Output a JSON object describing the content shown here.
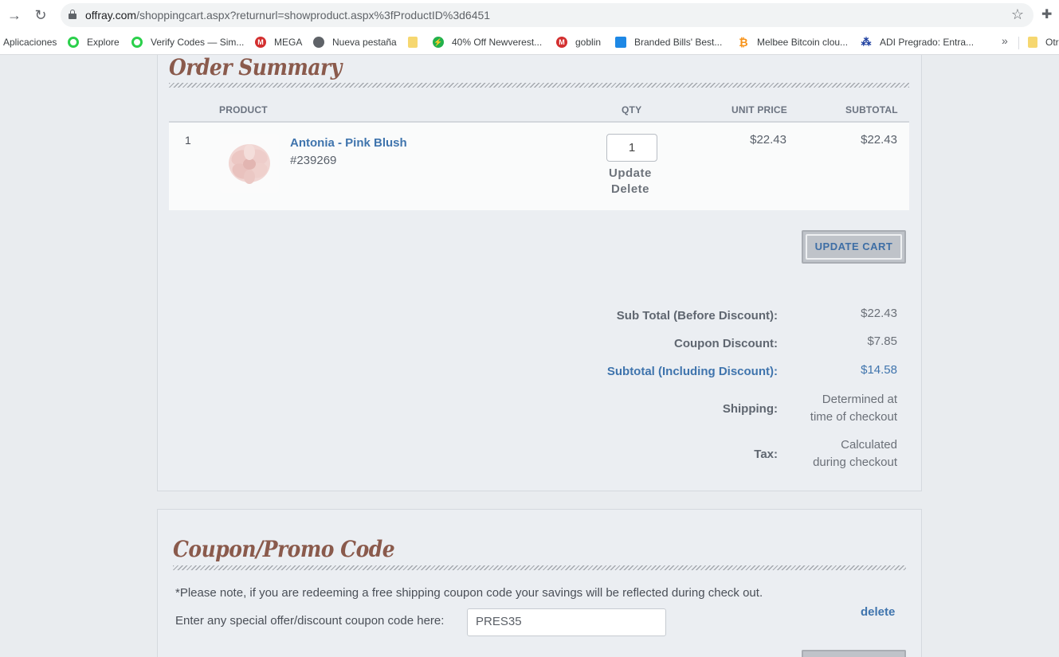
{
  "browser": {
    "url_host": "offray.com",
    "url_path": "/shoppingcart.aspx?returnurl=showproduct.aspx%3fProductID%3d6451",
    "bookmarks": [
      {
        "label": "Aplicaciones",
        "icon": "apps-grid-icon"
      },
      {
        "label": "Explore",
        "icon": "green-ring-icon"
      },
      {
        "label": "Verify Codes — Sim...",
        "icon": "green-ring-icon"
      },
      {
        "label": "MEGA",
        "icon": "mega-icon"
      },
      {
        "label": "Nueva pestaña",
        "icon": "globe-icon"
      },
      {
        "label": "",
        "icon": "folder-icon"
      },
      {
        "label": "40% Off Newverest...",
        "icon": "bolt-icon"
      },
      {
        "label": "goblin",
        "icon": "mega-icon"
      },
      {
        "label": "Branded Bills' Best...",
        "icon": "chat-icon"
      },
      {
        "label": "Melbee Bitcoin clou...",
        "icon": "bitcoin-icon"
      },
      {
        "label": "ADI Pregrado: Entra...",
        "icon": "adi-icon"
      },
      {
        "label": "Otr",
        "icon": "folder-icon"
      }
    ],
    "overflow": "»"
  },
  "order_summary": {
    "title": "Order Summary",
    "columns": {
      "product": "PRODUCT",
      "qty": "QTY",
      "unit_price": "UNIT PRICE",
      "subtotal": "SUBTOTAL"
    },
    "item": {
      "index": "1",
      "name": "Antonia - Pink Blush",
      "sku": "#239269",
      "qty": "1",
      "update_label": "Update",
      "delete_label": "Delete",
      "unit_price": "$22.43",
      "subtotal": "$22.43"
    },
    "update_cart_label": "UPDATE CART",
    "totals": {
      "sub_total_label": "Sub Total (Before Discount):",
      "sub_total_value": "$22.43",
      "coupon_label": "Coupon Discount:",
      "coupon_value": "$7.85",
      "subtotal_disc_label": "Subtotal (Including Discount):",
      "subtotal_disc_value": "$14.58",
      "shipping_label": "Shipping:",
      "shipping_value_1": "Determined at",
      "shipping_value_2": "time of checkout",
      "tax_label": "Tax:",
      "tax_value_1": "Calculated",
      "tax_value_2": "during checkout"
    }
  },
  "coupon": {
    "title": "Coupon/Promo Code",
    "note": "*Please note, if you are redeeming a free shipping coupon code your savings will be reflected during check out.",
    "input_label": "Enter any special offer/discount coupon code here:",
    "input_value": "PRES35",
    "delete_label": "delete"
  },
  "colors": {
    "accent_blue": "#3f74ad",
    "title_brown": "#8a5a4c",
    "panel_bg": "#ebeef2"
  }
}
